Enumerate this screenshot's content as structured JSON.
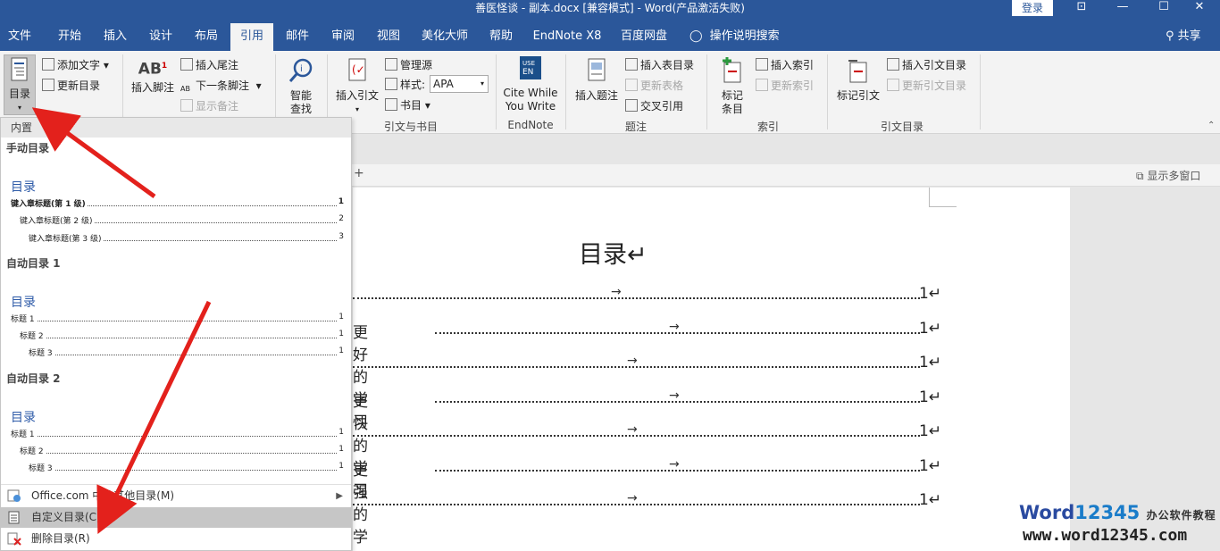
{
  "titlebar": {
    "title": "善医怪谈 - 副本.docx [兼容模式]  -  Word(产品激活失败)",
    "login": "登录",
    "ribbon_opts": "⊡",
    "minimize": "—",
    "maximize": "☐",
    "close": "✕"
  },
  "tabs": [
    {
      "label": "文件"
    },
    {
      "label": "开始"
    },
    {
      "label": "插入"
    },
    {
      "label": "设计"
    },
    {
      "label": "布局"
    },
    {
      "label": "引用"
    },
    {
      "label": "邮件"
    },
    {
      "label": "审阅"
    },
    {
      "label": "视图"
    },
    {
      "label": "美化大师"
    },
    {
      "label": "帮助"
    },
    {
      "label": "EndNote X8"
    },
    {
      "label": "百度网盘"
    }
  ],
  "tellme": "操作说明搜索",
  "share": "共享",
  "ribbon": {
    "toc": {
      "big": "目录",
      "add_text": "添加文字",
      "update": "更新目录"
    },
    "footnote": {
      "insert": "插入脚注",
      "insert_endnote": "插入尾注",
      "next": "下一条脚注",
      "show": "显示备注"
    },
    "research": {
      "smart": "智能",
      "lookup": "查找"
    },
    "citation": {
      "insert": "插入引文",
      "manage": "管理源",
      "style_label": "样式:",
      "style_value": "APA",
      "biblio": "书目",
      "group": "引文与书目"
    },
    "endnote": {
      "line1": "Cite While",
      "line2": "You Write",
      "group": "EndNote"
    },
    "caption": {
      "insert": "插入题注",
      "insert_table": "插入表目录",
      "update_table": "更新表格",
      "cross": "交叉引用",
      "group": "题注"
    },
    "index": {
      "mark1": "标记",
      "mark2": "条目",
      "insert": "插入索引",
      "update": "更新索引",
      "group": "索引"
    },
    "toa": {
      "mark": "标记引文",
      "insert": "插入引文目录",
      "update": "更新引文目录",
      "group": "引文目录"
    }
  },
  "multiwindow": "显示多窗口",
  "document": {
    "title": "目录↵",
    "lines": [
      {
        "text": "",
        "page": "1↵"
      },
      {
        "text": "更好的学习",
        "page": "1↵"
      },
      {
        "text": "",
        "page": "1↵"
      },
      {
        "text": "更快的学习",
        "page": "1↵"
      },
      {
        "text": "",
        "page": "1↵"
      },
      {
        "text": "更强的学习",
        "page": "1↵"
      },
      {
        "text": "",
        "page": "1↵"
      }
    ],
    "tab_arrow": "→"
  },
  "dropdown": {
    "header": "内置",
    "sections": [
      {
        "name": "手动目录",
        "toc_title": "目录",
        "entries": [
          {
            "label": "键入章标题(第 1 级)",
            "num": "1"
          },
          {
            "label": "键入章标题(第 2 级)",
            "num": "2"
          },
          {
            "label": "键入章标题(第 3 级)",
            "num": "3"
          }
        ]
      },
      {
        "name": "自动目录 1",
        "toc_title": "目录",
        "entries": [
          {
            "label": "标题 1",
            "num": "1"
          },
          {
            "label": "标题 2",
            "num": "1"
          },
          {
            "label": "标题 3",
            "num": "1"
          }
        ]
      },
      {
        "name": "自动目录 2",
        "toc_title": "目录",
        "entries": [
          {
            "label": "标题 1",
            "num": "1"
          },
          {
            "label": "标题 2",
            "num": "1"
          },
          {
            "label": "标题 3",
            "num": "1"
          }
        ]
      }
    ],
    "more": "Office.com 中的其他目录(M)",
    "custom": "自定义目录(C)...",
    "remove": "删除目录(R)"
  },
  "watermark": {
    "brand_a": "Word",
    "brand_b": "12345",
    "brand_cn": "办公软件教程",
    "url": "www.word12345.com"
  },
  "colors": {
    "word_blue": "#2b579a",
    "accent_red": "#e3211c",
    "toc_blue": "#2e5ba8"
  }
}
